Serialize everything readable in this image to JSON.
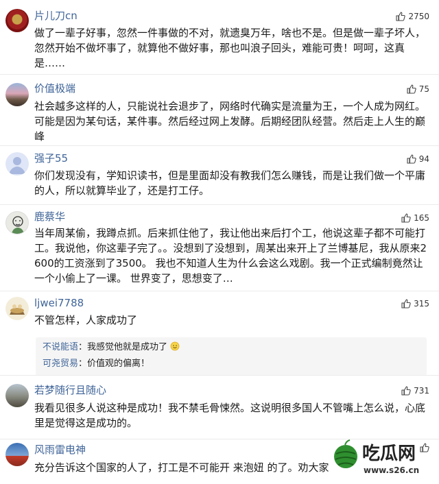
{
  "comments": [
    {
      "user": "片儿刀cn",
      "likes": "2750",
      "text": "做了一辈子好事，忽然一件事做的不对，就遗臭万年，啥也不是。但是做一辈子坏人，忽然开始不做坏事了，就算他不做好事，那也叫浪子回头，难能可贵！呵呵，这真是……"
    },
    {
      "user": "价值极端",
      "likes": "75",
      "text": "社会越多这样的人，只能说社会退步了，网络时代确实是流量为王，一个人成为网红。可能是因为某句话，某件事。然后经过网上发酵。后期经团队经营。然后走上人生的巅峰"
    },
    {
      "user": "强子55",
      "likes": "94",
      "text": "你们发现没有，学知识读书，但是里面却没有教我们怎么赚钱，而是让我们做一个平庸的人，所以就算毕业了，还是打工仔。"
    },
    {
      "user": "鹿蔡华",
      "likes": "165",
      "text": "当年周某偷，我蹲点抓。后来抓住他了，我让他出来后打个工，他说这辈子都不可能打工。我说他，你这辈子完了。。没想到了没想到，周某出来开上了兰博基尼，我从原来2600的工资涨到了3500。 我也不知道人生为什么会这么戏剧。我一个正式编制竟然让一个小偷上了一课。 世界变了，思想变了…"
    },
    {
      "user": "ljwei7788",
      "likes": "315",
      "text": "不管怎样，人家成功了",
      "replies": [
        {
          "name": "不说能语",
          "sep": "：",
          "text": "我感觉他就是成功了"
        },
        {
          "name": "可尧贸易",
          "sep": "：",
          "text": "价值观的偏离！"
        }
      ]
    },
    {
      "user": "若梦随行且随心",
      "likes": "731",
      "text": "我看见很多人说这种是成功！我不禁毛骨悚然。这说明很多国人不管嘴上怎么说，心底里是觉得这是成功的。"
    },
    {
      "user": "风雨雷电神",
      "likes": "",
      "text": "充分告诉这个国家的人了，打工是不可能开 来泡妞 的了。劝大家"
    }
  ],
  "watermark": {
    "brand": "吃瓜网",
    "url": "www.s26.cn"
  },
  "colors": {
    "username": "#406599",
    "text": "#1a1a1a",
    "reply_bg": "#f5f5f5",
    "divider": "#ebebeb"
  }
}
